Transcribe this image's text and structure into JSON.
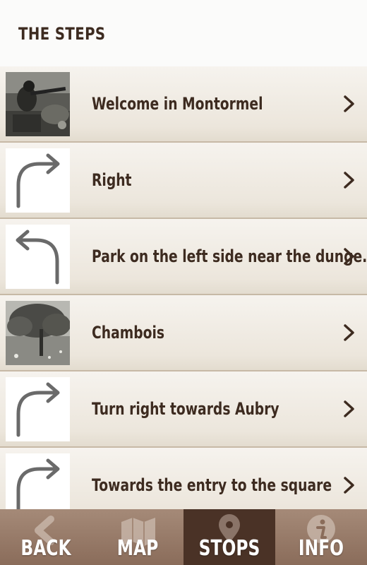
{
  "header": {
    "title": "THE STEPS"
  },
  "steps": [
    {
      "label": "Welcome in Montormel",
      "thumb": "photo-soldiers"
    },
    {
      "label": "Right",
      "thumb": "turn-right-icon"
    },
    {
      "label": "Park on the left side near the dunge...",
      "thumb": "turn-left-icon"
    },
    {
      "label": "Chambois",
      "thumb": "photo-tree"
    },
    {
      "label": "Turn right towards Aubry",
      "thumb": "turn-right-icon"
    },
    {
      "label": "Towards the entry to the square",
      "thumb": "turn-right-icon"
    }
  ],
  "tabs": [
    {
      "label": "BACK",
      "icon": "back-arrow-icon",
      "active": false
    },
    {
      "label": "MAP",
      "icon": "map-icon",
      "active": false
    },
    {
      "label": "STOPS",
      "icon": "pin-icon",
      "active": true
    },
    {
      "label": "INFO",
      "icon": "info-icon",
      "active": false
    }
  ],
  "colors": {
    "text": "#3d2b20",
    "tabbar": "#8a6c5a",
    "tab_active": "#4a3226"
  }
}
